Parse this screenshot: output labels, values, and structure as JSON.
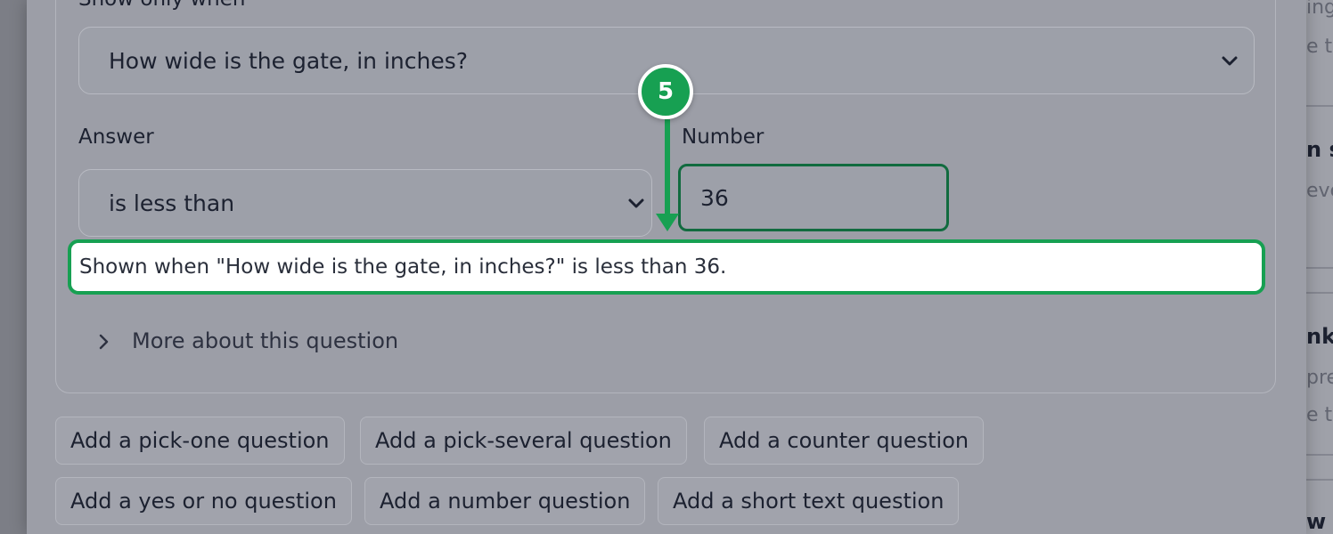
{
  "condition": {
    "show_only_when_label": "Show only when",
    "question_select_value": "How wide is the gate, in inches?",
    "answer_label": "Answer",
    "answer_select_value": "is less than",
    "number_label": "Number",
    "number_value": "36",
    "summary_text": "Shown when \"How wide is the gate, in inches?\" is less than 36."
  },
  "step_badge": "5",
  "more_about_label": "More about this question",
  "add_buttons": [
    "Add a pick-one question",
    "Add a pick-several question",
    "Add a counter question",
    "Add a yes or no question",
    "Add a number question",
    "Add a short text question"
  ],
  "background_page": {
    "fragments": [
      "ing",
      "e th",
      "n s",
      "eve",
      "nk",
      "pre",
      "e t",
      "w"
    ]
  },
  "colors": {
    "accent_green": "#17a052",
    "number_border": "#116b3f",
    "overlay": "#9c9ea7"
  },
  "icons": {
    "select_chevron": "chevron-down-icon",
    "more_chevron": "chevron-right-icon",
    "arrow": "arrow-down-icon"
  }
}
